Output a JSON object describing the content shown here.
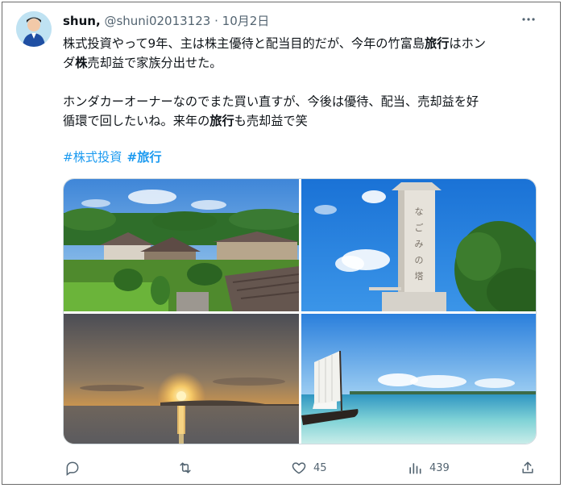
{
  "tweet": {
    "author_name": "shun,",
    "handle": "@shuni02013123",
    "separator": "·",
    "date": "10月2日",
    "text_line1_a": "株式投資やって9年、主は株主優待と配当目的だが、今年の竹富島",
    "text_line1_b": "旅行",
    "text_line1_c": "はホン",
    "text_line2_a": "ダ",
    "text_line2_b": "株",
    "text_line2_c": "売却益で家族分出せた。",
    "text_line3": "ホンダカーオーナーなのでまた買い直すが、今後は優待、配当、売却益を好",
    "text_line4_a": "循環で回したいね。来年の",
    "text_line4_b": "旅行",
    "text_line4_c": "も売却益で笑",
    "hashtag1": "#株式投資",
    "hashtag2": "#旅行"
  },
  "images": [
    {
      "name": "village-photo",
      "subject": "red-tiled houses of Taketomi village"
    },
    {
      "name": "monument-photo",
      "subject": "stone pillar monument and tree under blue sky"
    },
    {
      "name": "sunset-photo",
      "subject": "sunset over the sea"
    },
    {
      "name": "sailboat-photo",
      "subject": "traditional sailboat on shallow turquoise water"
    }
  ],
  "monument_inscription": "なごみの塔",
  "actions": {
    "reply_count": "",
    "retweet_count": "",
    "like_count": "45",
    "view_count": "439"
  },
  "colors": {
    "accent": "#1d9bf0",
    "text": "#0f1419",
    "muted": "#536471"
  },
  "icons": [
    "avatar",
    "more-icon",
    "reply-icon",
    "retweet-icon",
    "like-icon",
    "views-icon",
    "share-icon"
  ]
}
